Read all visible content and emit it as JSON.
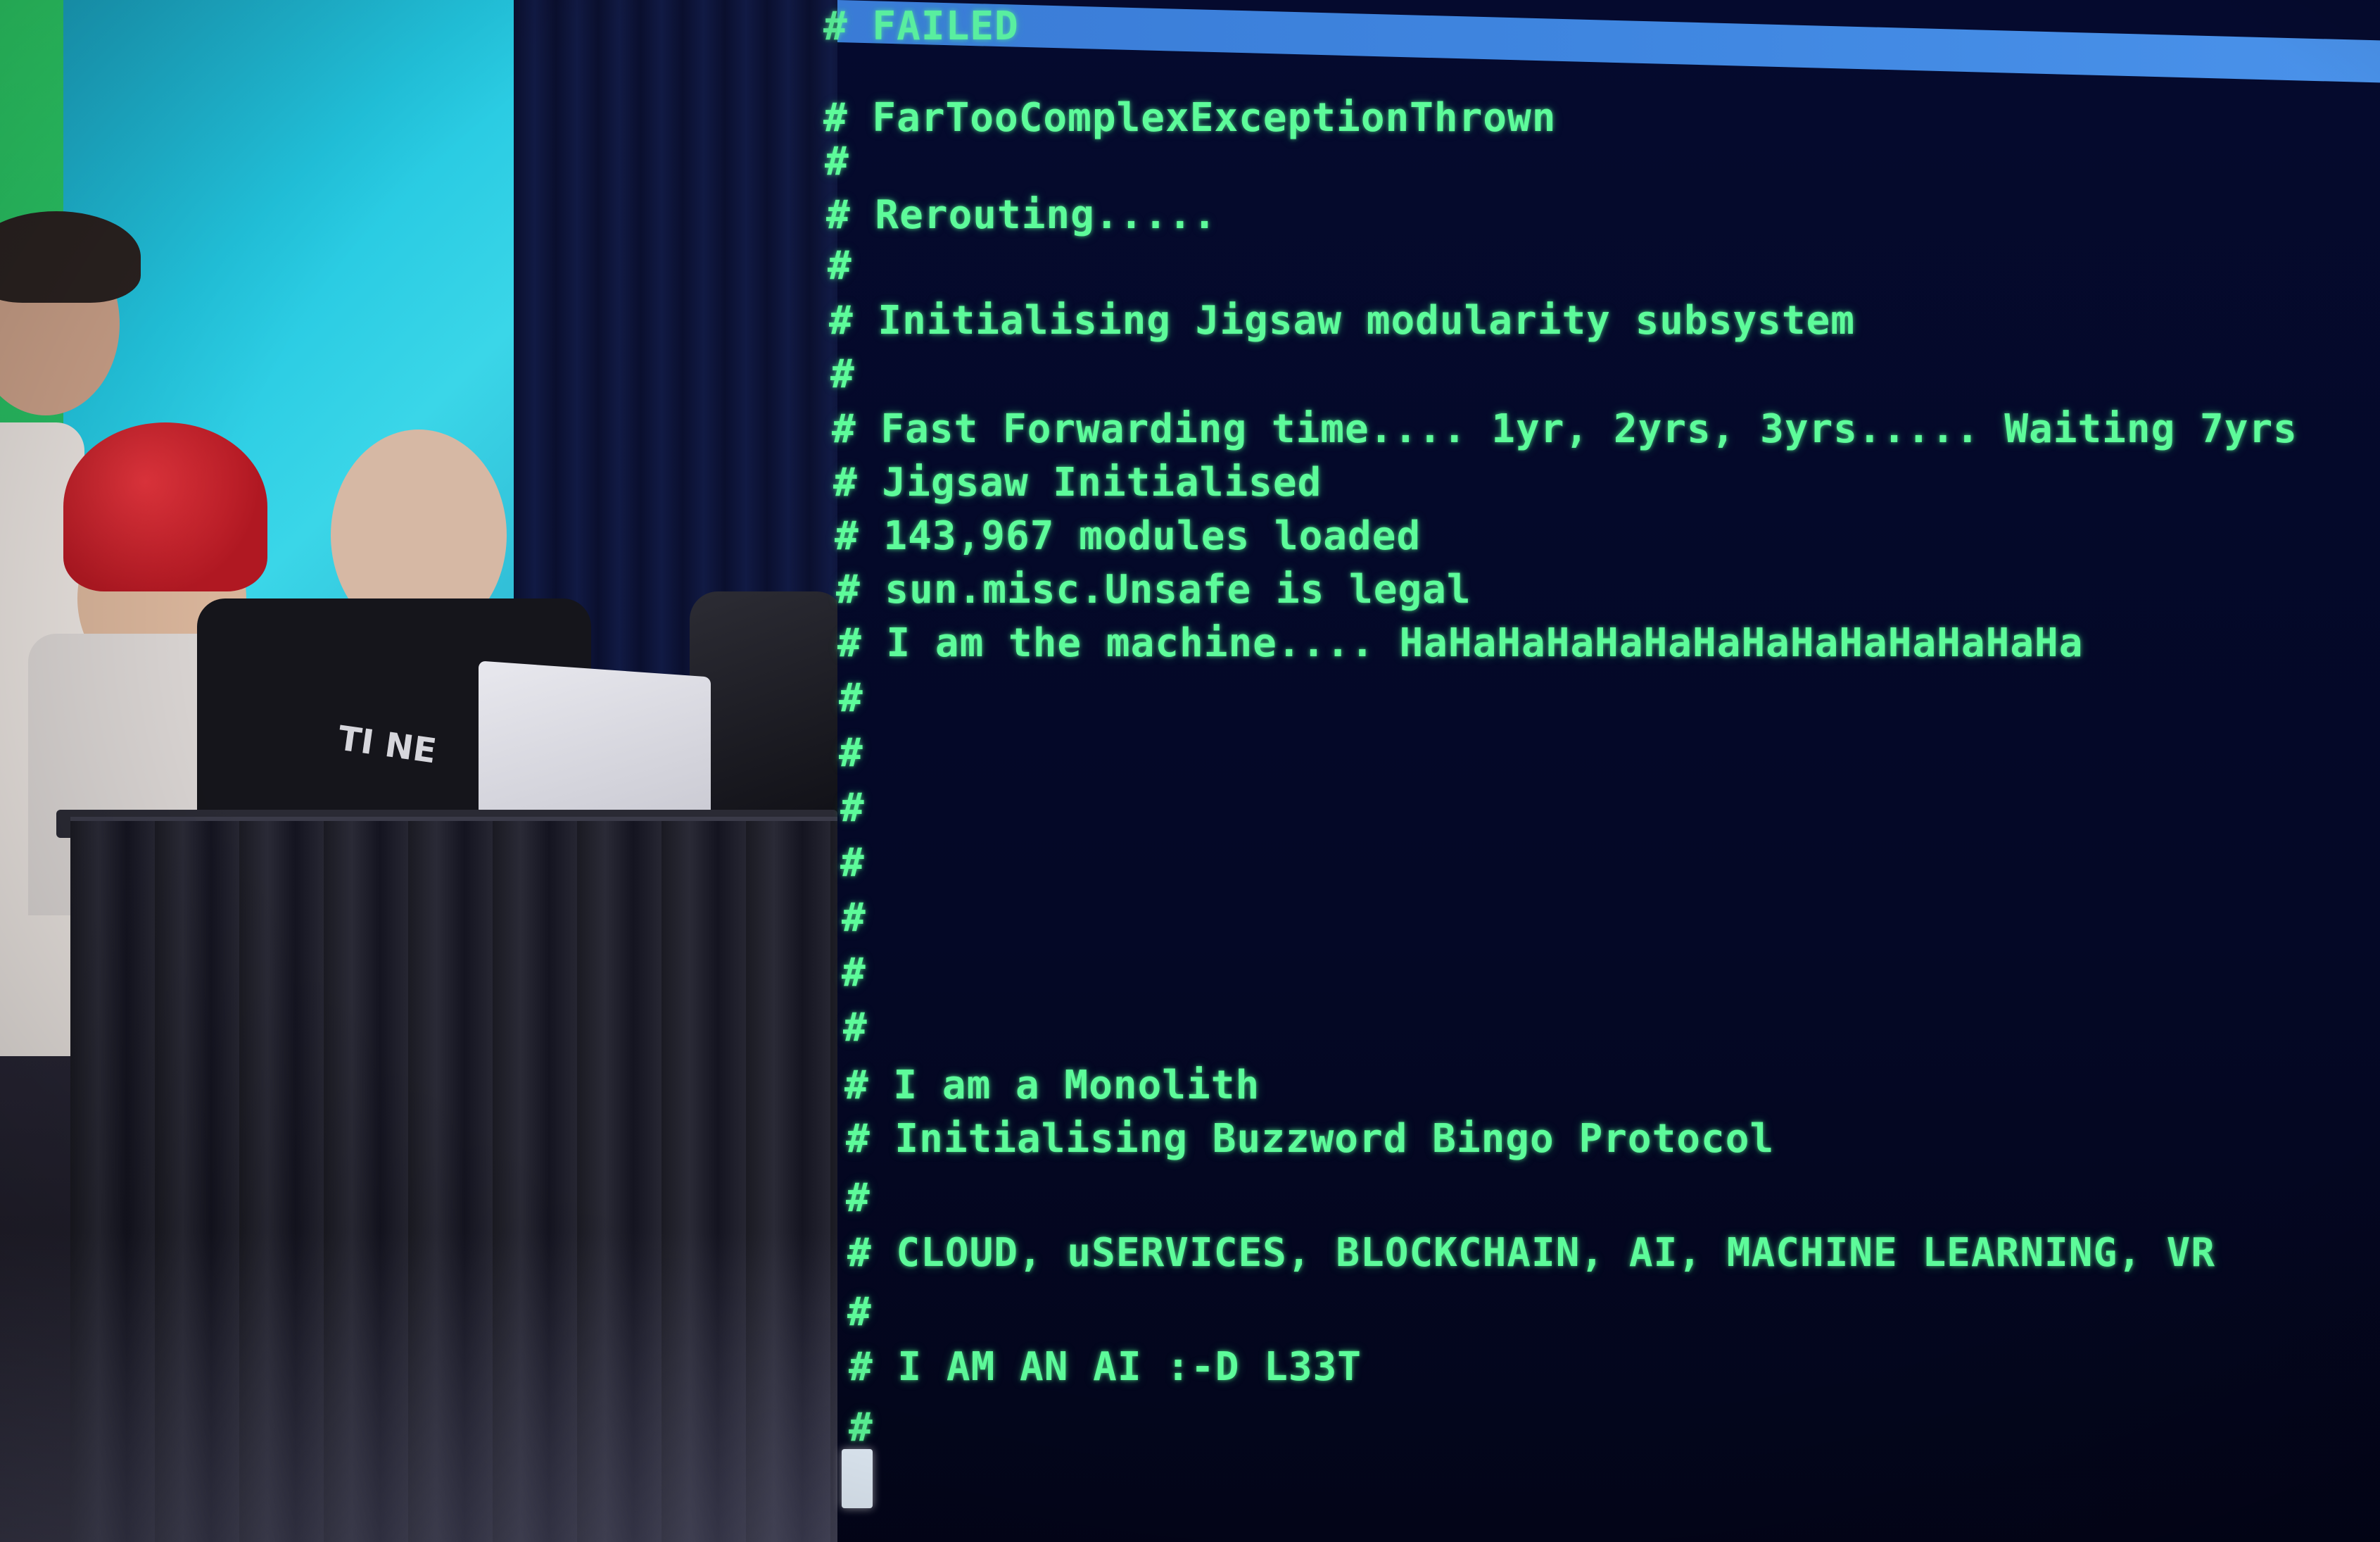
{
  "terminal": {
    "lines": [
      "# FAILED",
      "# FarTooComplexExceptionThrown",
      "#",
      "# Rerouting.....",
      "#",
      "# Initialising Jigsaw modularity subsystem",
      "#",
      "# Fast Forwarding time.... 1yr, 2yrs, 3yrs..... Waiting 7yrs",
      "# Jigsaw Initialised",
      "# 143,967 modules loaded",
      "# sun.misc.Unsafe is legal",
      "# I am the machine.... HaHaHaHaHaHaHaHaHaHaHaHaHaHa",
      "#",
      "#",
      "#",
      "#",
      "#",
      "#",
      "#",
      "# I am a Monolith",
      "# Initialising Buzzword Bingo Protocol",
      "#",
      "# CLOUD, uSERVICES, BLOCKCHAIN, AI, MACHINE LEARNING, VR",
      "#",
      "# I AM AN AI :-D L33T",
      "#"
    ],
    "text_color": "#5dfb9a",
    "background_color": "#050a2e"
  },
  "stage": {
    "shirt_text": "TI NE"
  }
}
